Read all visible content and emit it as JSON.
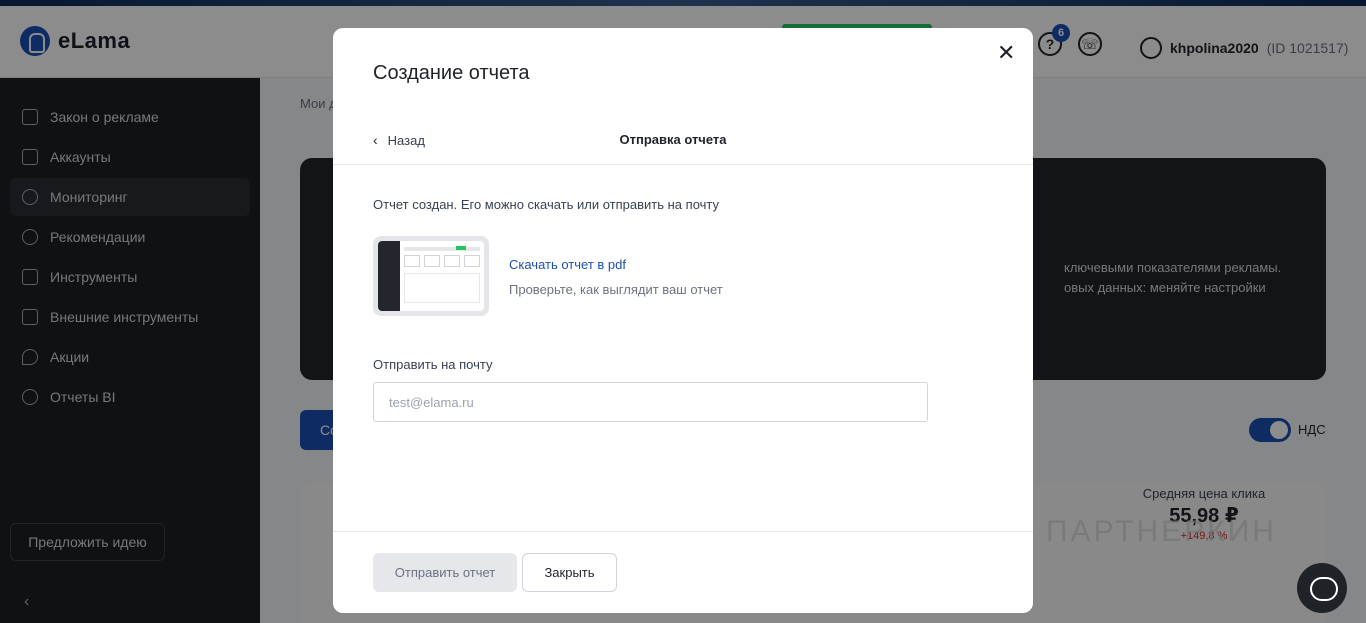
{
  "header": {
    "logo_text": "eLama",
    "notifications_count": "6",
    "username": "khpolina2020",
    "user_id": "(ID 1021517)"
  },
  "sidebar": {
    "items": [
      {
        "label": "Закон о рекламе",
        "icon": "law-icon"
      },
      {
        "label": "Аккаунты",
        "icon": "accounts-icon"
      },
      {
        "label": "Мониторинг",
        "icon": "monitoring-icon"
      },
      {
        "label": "Рекомендации",
        "icon": "recommendations-icon"
      },
      {
        "label": "Инструменты",
        "icon": "tools-icon"
      },
      {
        "label": "Внешние инструменты",
        "icon": "external-tools-icon"
      },
      {
        "label": "Акции",
        "icon": "promo-icon"
      },
      {
        "label": "Отчеты BI",
        "icon": "reports-bi-icon"
      }
    ],
    "active_index": 2,
    "idea_button": "Предложить идею"
  },
  "background": {
    "breadcrumb": "Мои д",
    "banner_text_1": "ключевыми показателями рекламы.",
    "banner_text_2": "овых данных: меняйте настройки",
    "blue_button": "Со",
    "vat_label": "НДС",
    "stat_label": "Средняя цена клика",
    "stat_value": "55,98 ₽",
    "stat_delta": "+149,8 %",
    "watermark": "ПАРТНЕРКИН"
  },
  "modal": {
    "title": "Создание отчета",
    "back_label": "Назад",
    "step_title": "Отправка отчета",
    "info_text": "Отчет создан. Его можно скачать или отправить на почту",
    "download_link": "Скачать отчет в pdf",
    "download_hint": "Проверьте, как выглядит ваш отчет",
    "email_label": "Отправить на почту",
    "email_placeholder": "test@elama.ru",
    "email_value": "",
    "send_button": "Отправить отчет",
    "close_button": "Закрыть"
  }
}
